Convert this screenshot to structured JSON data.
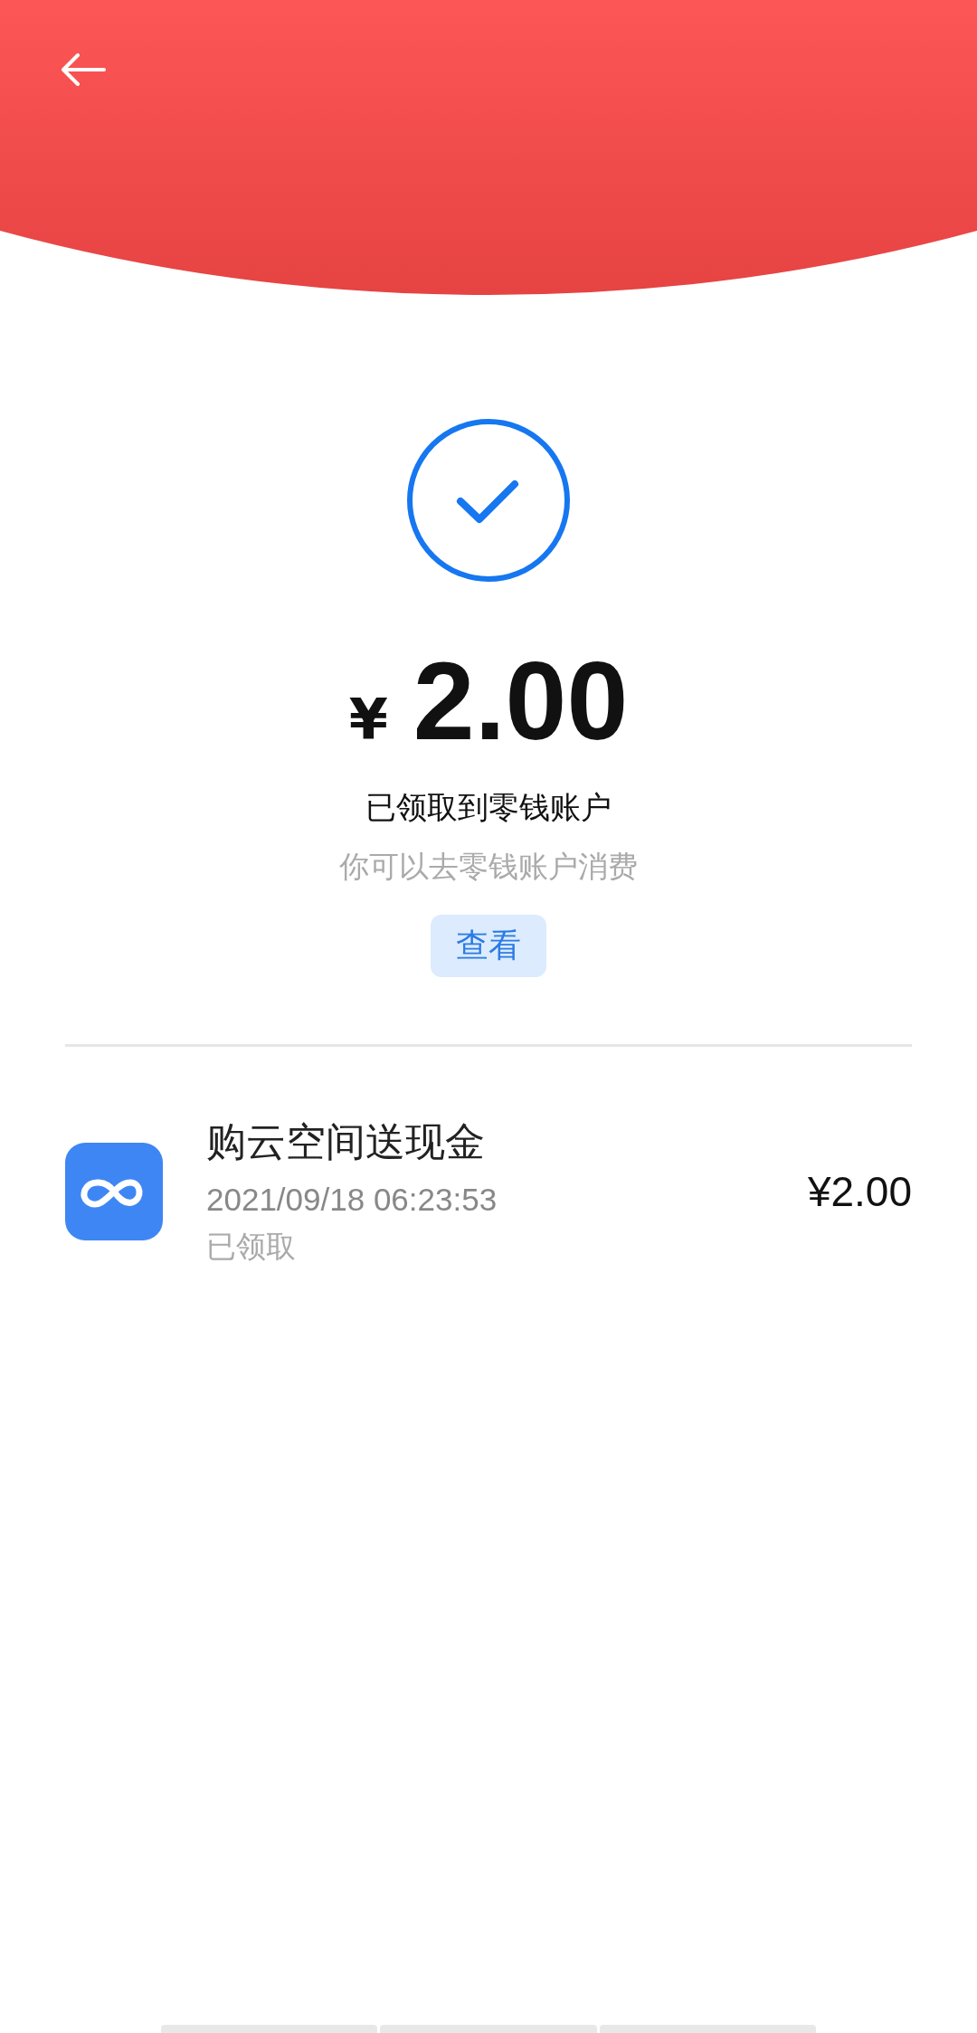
{
  "result": {
    "currency": "¥",
    "amount": "2.00",
    "message": "已领取到零钱账户",
    "hint": "你可以去零钱账户消费",
    "button": "查看"
  },
  "records": [
    {
      "title": "购云空间送现金",
      "time": "2021/09/18 06:23:53",
      "status": "已领取",
      "amount": "¥2.00"
    }
  ]
}
